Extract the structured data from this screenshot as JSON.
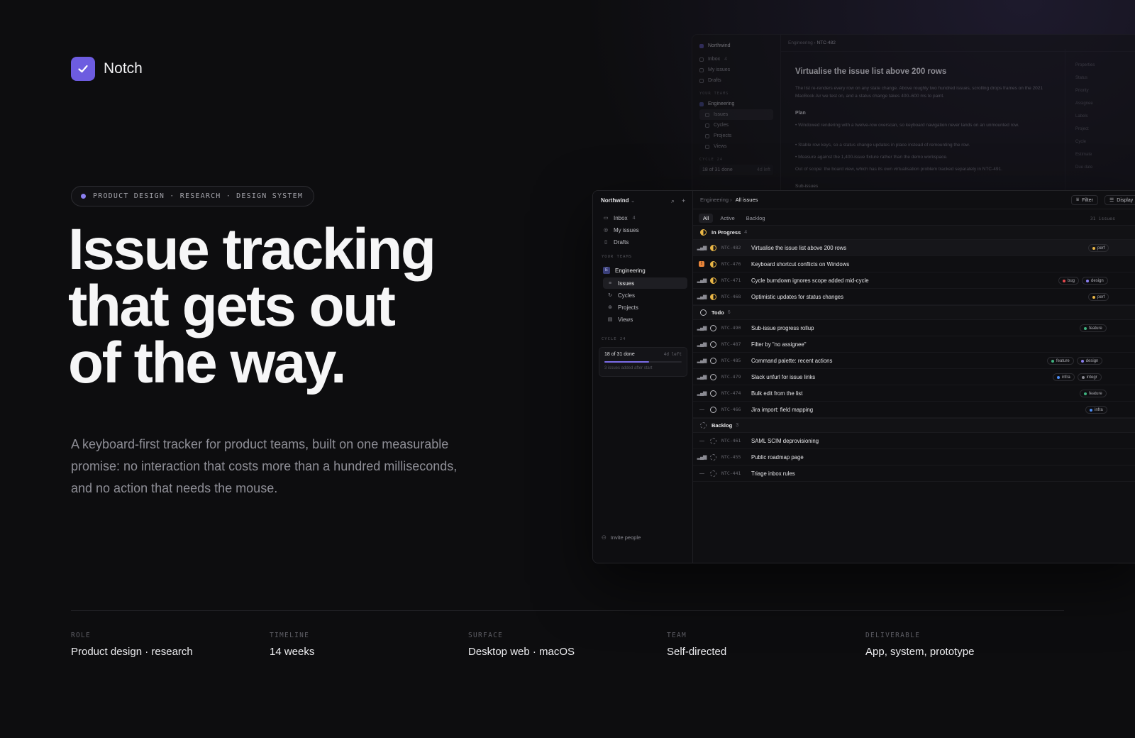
{
  "brand": {
    "name": "Notch",
    "accent": "#6d5ce0"
  },
  "tagline": "PRODUCT DESIGN · RESEARCH · DESIGN SYSTEM",
  "headline": [
    "Issue tracking",
    "that gets out",
    "of the way."
  ],
  "lede": "A keyboard-first tracker for product teams, built on one measurable promise: no interaction that costs more than a hundred milliseconds, and no action that needs the mouse.",
  "meta": [
    {
      "label": "ROLE",
      "value": "Product design · research"
    },
    {
      "label": "TIMELINE",
      "value": "14 weeks"
    },
    {
      "label": "SURFACE",
      "value": "Desktop web · macOS"
    },
    {
      "label": "TEAM",
      "value": "Self-directed"
    },
    {
      "label": "DELIVERABLE",
      "value": "App, system, prototype"
    }
  ],
  "back_window": {
    "workspace": "Northwind",
    "crumb_team": "Engineering",
    "crumb_id": "NTC-482",
    "nav": [
      "Inbox",
      "My issues",
      "Drafts"
    ],
    "inbox_count": "4",
    "team_section": "YOUR TEAMS",
    "team": "Engineering",
    "team_nav": [
      "Issues",
      "Cycles",
      "Projects",
      "Views"
    ],
    "cycle_section": "CYCLE 24",
    "cycle_done": "18 of 31 done",
    "cycle_left": "4d left",
    "title": "Virtualise the issue list above 200 rows",
    "body": "The list re-renders every row on any state change. Above roughly two hundred issues, scrolling drops frames on the 2021 MacBook Air we test on, and a status change takes 400–600 ms to paint.",
    "plan_heading": "Plan",
    "plan": [
      "Windowed rendering with a twelve-row overscan, so keyboard navigation never lands on an unmounted row.",
      "Stable row keys, so a status change updates in place instead of remounting the row.",
      "Measure against the 1,400-issue fixture rather than the demo workspace."
    ],
    "scope": "Out of scope: the board view, which has its own virtualisation problem tracked separately in NTC-491.",
    "subissues": "Sub-issues",
    "properties": [
      "Properties",
      "Status",
      "Priority",
      "Assignee",
      "Labels",
      "Project",
      "Cycle",
      "Estimate",
      "Due date"
    ]
  },
  "front_window": {
    "workspace": "Northwind",
    "nav": [
      {
        "label": "Inbox",
        "count": "4",
        "icon": "inbox-icon"
      },
      {
        "label": "My issues",
        "count": "",
        "icon": "target-icon"
      },
      {
        "label": "Drafts",
        "count": "",
        "icon": "draft-icon"
      }
    ],
    "team_section": "YOUR TEAMS",
    "team_badge": "E",
    "team": "Engineering",
    "team_nav": [
      "Issues",
      "Cycles",
      "Projects",
      "Views"
    ],
    "cycle_section": "CYCLE 24",
    "cycle_done": "18 of 31 done",
    "cycle_left": "4d left",
    "cycle_progress": 0.58,
    "cycle_note": "3 issues added after start",
    "invite": "Invite people",
    "crumb_team": "Engineering",
    "crumb_view": "All issues",
    "filter": "Filter",
    "display": "Display",
    "tabs": [
      "All",
      "Active",
      "Backlog"
    ],
    "issue_count": "31 issues",
    "groups": [
      {
        "name": "In Progress",
        "count": "4"
      },
      {
        "name": "Todo",
        "count": "6"
      },
      {
        "name": "Backlog",
        "count": "3"
      }
    ],
    "issues": [
      {
        "id": "NTC-482",
        "title": "Virtualise the issue list above 200 rows",
        "labels": [
          "perf"
        ]
      },
      {
        "id": "NTC-476",
        "title": "Keyboard shortcut conflicts on Windows",
        "labels": []
      },
      {
        "id": "NTC-471",
        "title": "Cycle burndown ignores scope added mid-cycle",
        "labels": [
          "bug",
          "design"
        ]
      },
      {
        "id": "NTC-468",
        "title": "Optimistic updates for status changes",
        "labels": [
          "perf"
        ]
      },
      {
        "id": "NTC-490",
        "title": "Sub-issue progress rollup",
        "labels": [
          "feature"
        ]
      },
      {
        "id": "NTC-487",
        "title": "Filter by \"no assignee\"",
        "labels": []
      },
      {
        "id": "NTC-485",
        "title": "Command palette: recent actions",
        "labels": [
          "feature",
          "design"
        ]
      },
      {
        "id": "NTC-479",
        "title": "Slack unfurl for issue links",
        "labels": [
          "infra",
          "integr"
        ]
      },
      {
        "id": "NTC-474",
        "title": "Bulk edit from the list",
        "labels": [
          "feature"
        ]
      },
      {
        "id": "NTC-466",
        "title": "Jira import: field mapping",
        "labels": [
          "infra"
        ]
      },
      {
        "id": "NTC-461",
        "title": "SAML SCIM deprovisioning",
        "labels": []
      },
      {
        "id": "NTC-455",
        "title": "Public roadmap page",
        "labels": []
      },
      {
        "id": "NTC-441",
        "title": "Triage inbox rules",
        "labels": []
      }
    ],
    "label_colors": {
      "perf": "#e9b646",
      "bug": "#e5484d",
      "design": "#8b7ff0",
      "feature": "#3fb27f",
      "infra": "#4c8df6",
      "integr": "#8a8a92"
    }
  }
}
